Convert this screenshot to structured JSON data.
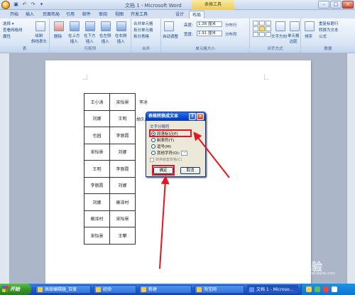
{
  "window": {
    "title": "文档 1 - Microsoft Word",
    "context_tab_group": "表格工具",
    "controls": [
      "–",
      "□",
      "×"
    ]
  },
  "tabs": [
    "开始",
    "插入",
    "页面布局",
    "引用",
    "邮件",
    "审阅",
    "视图",
    "开发工具",
    "设计",
    "布局"
  ],
  "ribbon": {
    "groups": [
      "表",
      "行和列",
      "合并",
      "单元格大小",
      "对齐方式",
      "数据"
    ],
    "table_group": {
      "select": "选择 ▾",
      "view_gridlines": "查看网格线",
      "properties": "属性",
      "draw": "绘制\n斜线表头"
    },
    "rows_cols": {
      "delete": "删除",
      "insert_above": "在上方\n插入",
      "insert_below": "在下方\n插入",
      "insert_left": "在左侧\n插入",
      "insert_right": "在右侧\n插入"
    },
    "merge": {
      "merge_cells": "合并单元格",
      "split_cells": "拆分单元格",
      "split_table": "拆分表格"
    },
    "cell_size": {
      "autofit": "自动调整",
      "height_label": "高度:",
      "height": "1.38 厘米",
      "width_label": "宽度:",
      "width": "1.91 厘米",
      "dist_rows": "分布行",
      "dist_cols": "分布列"
    },
    "alignment": {
      "text_direction": "文字方向",
      "cell_margins": "单元格\n边距"
    },
    "data": {
      "sort": "排序",
      "repeat_header": "重复标题行",
      "convert": "转换为文本",
      "formula": "公式"
    }
  },
  "table": {
    "rows": [
      [
        "王小涛",
        "宋怡景"
      ],
      [
        "刘娜",
        "王明"
      ],
      [
        "也园",
        "李丽霞"
      ],
      [
        "宋怡景",
        "刘娜"
      ],
      [
        "王明",
        "李丽霞"
      ],
      [
        "李丽霞",
        "刘娜"
      ],
      [
        "刘娜",
        "瘌泽村"
      ],
      [
        "瘌泽村",
        "宋怡景"
      ],
      [
        "宋怡景",
        "王攀"
      ]
    ],
    "outside_text": [
      "李冰",
      "胡久山"
    ]
  },
  "dialog": {
    "title": "表格转换成文本",
    "help": "?",
    "close": "×",
    "section": "文字分隔符",
    "options": [
      "段落标记(P)",
      "制表符(T)",
      "逗号(M)",
      "其他字符(O):"
    ],
    "other_char": "-",
    "nested_checkbox": "转换嵌套表格(C)",
    "ok": "确定",
    "cancel": "取消"
  },
  "taskbar": {
    "start": "开始",
    "tasks": [
      "高级编辑器_百度",
      "经验",
      "新建",
      "淘宝网",
      "文档 1 - Microso..."
    ]
  },
  "watermark": {
    "brand": "Bai 经验",
    "url": "jingyan.baidu.com"
  },
  "colors": {
    "highlight": "#e8141e",
    "title_bar": "#0a4ed0",
    "taskbar": "#245edb"
  }
}
